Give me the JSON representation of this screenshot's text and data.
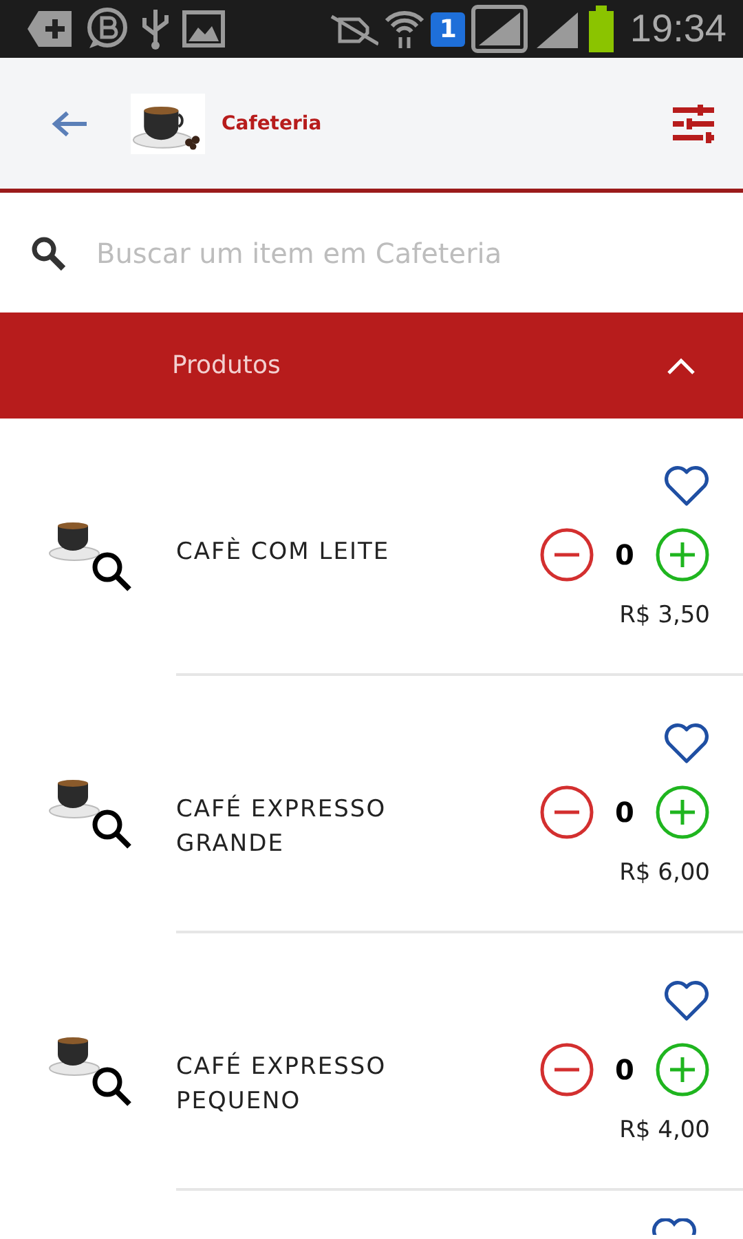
{
  "status_bar": {
    "time": "19:34",
    "sim_badge": "1"
  },
  "header": {
    "store_name": "Cafeteria"
  },
  "search": {
    "placeholder": "Buscar um item em Cafeteria"
  },
  "section": {
    "title": "Produtos",
    "expanded": true
  },
  "products": [
    {
      "name": "CAFÈ COM LEITE",
      "quantity": "0",
      "price": "R$ 3,50",
      "favorite": false
    },
    {
      "name": "CAFÉ EXPRESSO GRANDE",
      "quantity": "0",
      "price": "R$ 6,00",
      "favorite": false
    },
    {
      "name": "CAFÉ EXPRESSO PEQUENO",
      "quantity": "0",
      "price": "R$ 4,00",
      "favorite": false
    }
  ]
}
